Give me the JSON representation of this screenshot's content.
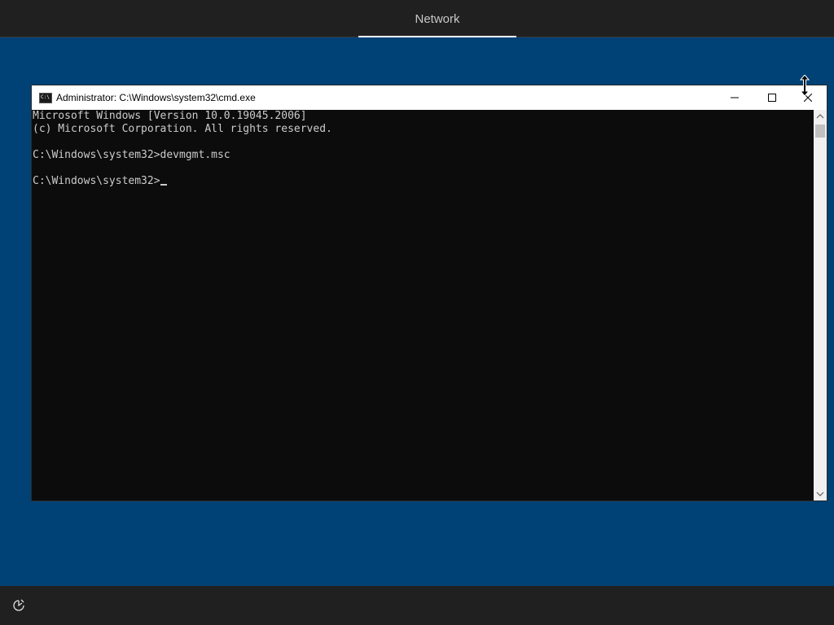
{
  "topbar": {
    "tabs": [
      {
        "label": "Network",
        "active": true
      }
    ]
  },
  "cmd_window": {
    "title": "Administrator: C:\\Windows\\system32\\cmd.exe",
    "icon": "cmd-icon",
    "controls": [
      "minimize-icon",
      "maximize-icon",
      "close-icon"
    ],
    "console_lines": [
      "Microsoft Windows [Version 10.0.19045.2006]",
      "(c) Microsoft Corporation. All rights reserved.",
      "",
      "C:\\Windows\\system32>devmgmt.msc",
      "",
      "C:\\Windows\\system32>"
    ]
  },
  "bottombar": {
    "icon": "accessibility-icon"
  },
  "colors": {
    "desktop_background": "#004275",
    "bar_background": "#202020",
    "console_background": "#0c0c0c",
    "console_text": "#cccccc",
    "titlebar_background": "#ffffff"
  }
}
